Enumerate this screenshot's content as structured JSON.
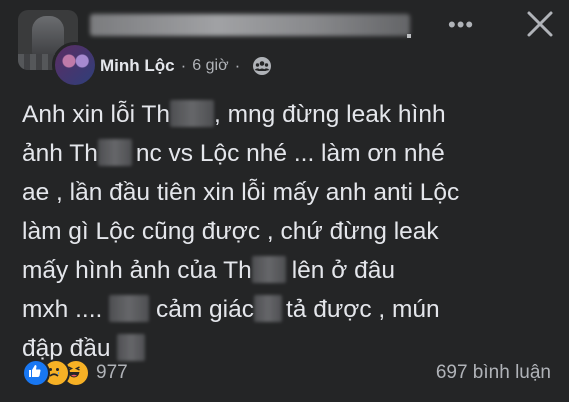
{
  "post": {
    "author": "Minh Lộc",
    "separator": "·",
    "time": "6 giờ",
    "more_label": "•••",
    "lines": [
      [
        "Anh xin lỗi Th",
        "",
        ", mng đừng leak hình"
      ],
      [
        "ảnh Th",
        "",
        "nc vs Lộc nhé ... làm ơn nhé"
      ],
      [
        "ae , lần đầu tiên xin lỗi mấy anh anti Lộc"
      ],
      [
        "làm gì Lộc cũng được , chứ đừng leak"
      ],
      [
        "mấy hình ảnh của Th",
        "",
        "lên ở đâu"
      ],
      [
        "mxh .... ",
        "",
        " cảm giác",
        "",
        "tả được , mún"
      ],
      [
        "đập đầu ",
        ""
      ]
    ]
  },
  "footer": {
    "reaction_count": "977",
    "comment_count": "697 bình luận"
  },
  "icons": {
    "audience": "friends-group-icon",
    "reactions": [
      "like-icon",
      "sad-icon",
      "haha-icon"
    ]
  },
  "colors": {
    "background": "#242526",
    "text": "#e4e6eb",
    "secondary_text": "#b0b3b8",
    "like_blue": "#1877f2",
    "emoji_yellow": "#f7b125"
  }
}
